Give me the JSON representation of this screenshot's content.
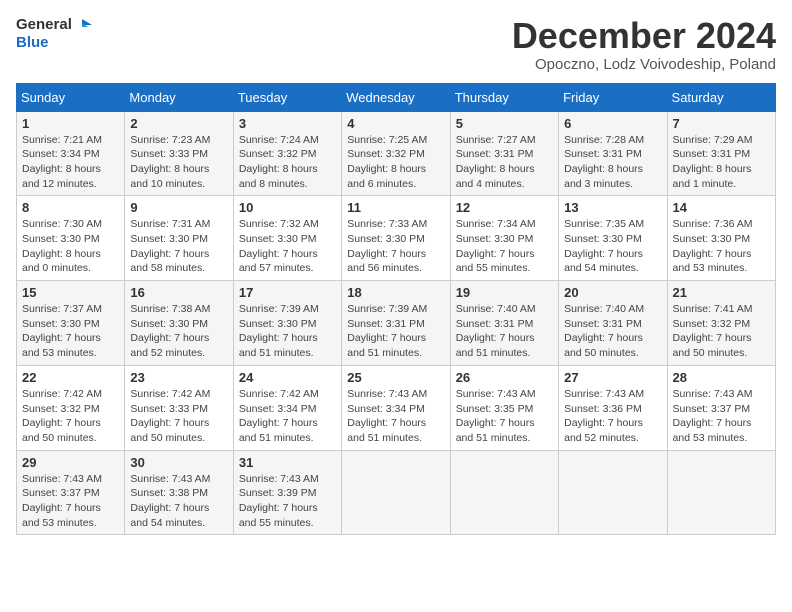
{
  "header": {
    "logo_line1": "General",
    "logo_line2": "Blue",
    "month": "December 2024",
    "location": "Opoczno, Lodz Voivodeship, Poland"
  },
  "weekdays": [
    "Sunday",
    "Monday",
    "Tuesday",
    "Wednesday",
    "Thursday",
    "Friday",
    "Saturday"
  ],
  "weeks": [
    [
      {
        "day": "1",
        "sunrise": "Sunrise: 7:21 AM",
        "sunset": "Sunset: 3:34 PM",
        "daylight": "Daylight: 8 hours and 12 minutes."
      },
      {
        "day": "2",
        "sunrise": "Sunrise: 7:23 AM",
        "sunset": "Sunset: 3:33 PM",
        "daylight": "Daylight: 8 hours and 10 minutes."
      },
      {
        "day": "3",
        "sunrise": "Sunrise: 7:24 AM",
        "sunset": "Sunset: 3:32 PM",
        "daylight": "Daylight: 8 hours and 8 minutes."
      },
      {
        "day": "4",
        "sunrise": "Sunrise: 7:25 AM",
        "sunset": "Sunset: 3:32 PM",
        "daylight": "Daylight: 8 hours and 6 minutes."
      },
      {
        "day": "5",
        "sunrise": "Sunrise: 7:27 AM",
        "sunset": "Sunset: 3:31 PM",
        "daylight": "Daylight: 8 hours and 4 minutes."
      },
      {
        "day": "6",
        "sunrise": "Sunrise: 7:28 AM",
        "sunset": "Sunset: 3:31 PM",
        "daylight": "Daylight: 8 hours and 3 minutes."
      },
      {
        "day": "7",
        "sunrise": "Sunrise: 7:29 AM",
        "sunset": "Sunset: 3:31 PM",
        "daylight": "Daylight: 8 hours and 1 minute."
      }
    ],
    [
      {
        "day": "8",
        "sunrise": "Sunrise: 7:30 AM",
        "sunset": "Sunset: 3:30 PM",
        "daylight": "Daylight: 8 hours and 0 minutes."
      },
      {
        "day": "9",
        "sunrise": "Sunrise: 7:31 AM",
        "sunset": "Sunset: 3:30 PM",
        "daylight": "Daylight: 7 hours and 58 minutes."
      },
      {
        "day": "10",
        "sunrise": "Sunrise: 7:32 AM",
        "sunset": "Sunset: 3:30 PM",
        "daylight": "Daylight: 7 hours and 57 minutes."
      },
      {
        "day": "11",
        "sunrise": "Sunrise: 7:33 AM",
        "sunset": "Sunset: 3:30 PM",
        "daylight": "Daylight: 7 hours and 56 minutes."
      },
      {
        "day": "12",
        "sunrise": "Sunrise: 7:34 AM",
        "sunset": "Sunset: 3:30 PM",
        "daylight": "Daylight: 7 hours and 55 minutes."
      },
      {
        "day": "13",
        "sunrise": "Sunrise: 7:35 AM",
        "sunset": "Sunset: 3:30 PM",
        "daylight": "Daylight: 7 hours and 54 minutes."
      },
      {
        "day": "14",
        "sunrise": "Sunrise: 7:36 AM",
        "sunset": "Sunset: 3:30 PM",
        "daylight": "Daylight: 7 hours and 53 minutes."
      }
    ],
    [
      {
        "day": "15",
        "sunrise": "Sunrise: 7:37 AM",
        "sunset": "Sunset: 3:30 PM",
        "daylight": "Daylight: 7 hours and 53 minutes."
      },
      {
        "day": "16",
        "sunrise": "Sunrise: 7:38 AM",
        "sunset": "Sunset: 3:30 PM",
        "daylight": "Daylight: 7 hours and 52 minutes."
      },
      {
        "day": "17",
        "sunrise": "Sunrise: 7:39 AM",
        "sunset": "Sunset: 3:30 PM",
        "daylight": "Daylight: 7 hours and 51 minutes."
      },
      {
        "day": "18",
        "sunrise": "Sunrise: 7:39 AM",
        "sunset": "Sunset: 3:31 PM",
        "daylight": "Daylight: 7 hours and 51 minutes."
      },
      {
        "day": "19",
        "sunrise": "Sunrise: 7:40 AM",
        "sunset": "Sunset: 3:31 PM",
        "daylight": "Daylight: 7 hours and 51 minutes."
      },
      {
        "day": "20",
        "sunrise": "Sunrise: 7:40 AM",
        "sunset": "Sunset: 3:31 PM",
        "daylight": "Daylight: 7 hours and 50 minutes."
      },
      {
        "day": "21",
        "sunrise": "Sunrise: 7:41 AM",
        "sunset": "Sunset: 3:32 PM",
        "daylight": "Daylight: 7 hours and 50 minutes."
      }
    ],
    [
      {
        "day": "22",
        "sunrise": "Sunrise: 7:42 AM",
        "sunset": "Sunset: 3:32 PM",
        "daylight": "Daylight: 7 hours and 50 minutes."
      },
      {
        "day": "23",
        "sunrise": "Sunrise: 7:42 AM",
        "sunset": "Sunset: 3:33 PM",
        "daylight": "Daylight: 7 hours and 50 minutes."
      },
      {
        "day": "24",
        "sunrise": "Sunrise: 7:42 AM",
        "sunset": "Sunset: 3:34 PM",
        "daylight": "Daylight: 7 hours and 51 minutes."
      },
      {
        "day": "25",
        "sunrise": "Sunrise: 7:43 AM",
        "sunset": "Sunset: 3:34 PM",
        "daylight": "Daylight: 7 hours and 51 minutes."
      },
      {
        "day": "26",
        "sunrise": "Sunrise: 7:43 AM",
        "sunset": "Sunset: 3:35 PM",
        "daylight": "Daylight: 7 hours and 51 minutes."
      },
      {
        "day": "27",
        "sunrise": "Sunrise: 7:43 AM",
        "sunset": "Sunset: 3:36 PM",
        "daylight": "Daylight: 7 hours and 52 minutes."
      },
      {
        "day": "28",
        "sunrise": "Sunrise: 7:43 AM",
        "sunset": "Sunset: 3:37 PM",
        "daylight": "Daylight: 7 hours and 53 minutes."
      }
    ],
    [
      {
        "day": "29",
        "sunrise": "Sunrise: 7:43 AM",
        "sunset": "Sunset: 3:37 PM",
        "daylight": "Daylight: 7 hours and 53 minutes."
      },
      {
        "day": "30",
        "sunrise": "Sunrise: 7:43 AM",
        "sunset": "Sunset: 3:38 PM",
        "daylight": "Daylight: 7 hours and 54 minutes."
      },
      {
        "day": "31",
        "sunrise": "Sunrise: 7:43 AM",
        "sunset": "Sunset: 3:39 PM",
        "daylight": "Daylight: 7 hours and 55 minutes."
      },
      null,
      null,
      null,
      null
    ]
  ]
}
